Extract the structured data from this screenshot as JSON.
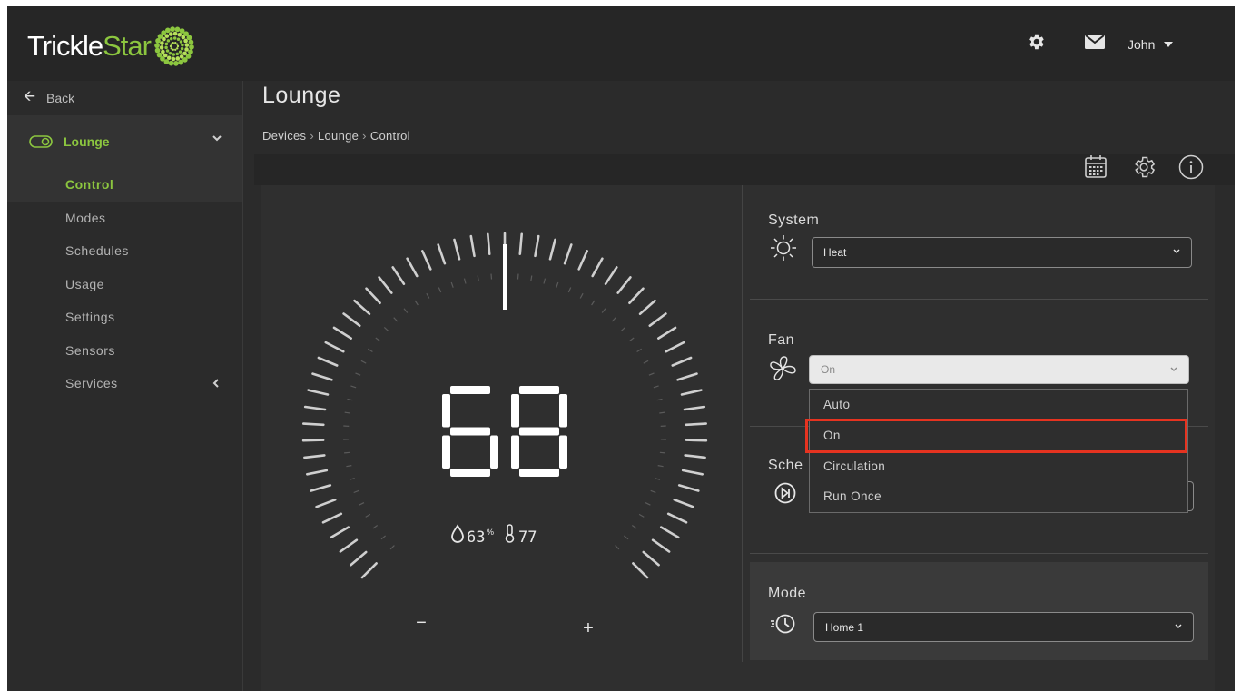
{
  "brand": {
    "name_part1": "Trickle",
    "name_part2": "Star",
    "accent": "#8cc63f"
  },
  "topbar": {
    "icons": [
      "gear-icon",
      "mail-icon"
    ],
    "user": "John"
  },
  "sidebar": {
    "back_label": "Back",
    "device": {
      "name": "Lounge",
      "icon": "toggle-icon"
    },
    "items": [
      {
        "label": "Control",
        "active": true
      },
      {
        "label": "Modes"
      },
      {
        "label": "Schedules"
      },
      {
        "label": "Usage"
      },
      {
        "label": "Settings"
      },
      {
        "label": "Sensors"
      },
      {
        "label": "Services"
      }
    ]
  },
  "page": {
    "title": "Lounge",
    "breadcrumb": [
      "Devices",
      "Lounge",
      "Control"
    ],
    "header_icons": [
      "calendar-icon",
      "settings-icon",
      "info-icon"
    ]
  },
  "thermostat": {
    "setpoint": "68",
    "humidity": "63",
    "humidity_unit": "%",
    "temperature": "77",
    "minus": "−",
    "plus": "+"
  },
  "controls": {
    "system": {
      "label": "System",
      "value": "Heat",
      "icon": "sun-icon"
    },
    "fan": {
      "label": "Fan",
      "value": "On",
      "icon": "fan-icon",
      "options": [
        "Auto",
        "On",
        "Circulation",
        "Run Once"
      ],
      "highlighted": "On"
    },
    "schedule": {
      "label": "Sche",
      "icon": "skip-icon"
    },
    "mode": {
      "label": "Mode",
      "value": "Home 1",
      "icon": "clock-icon"
    }
  },
  "colors": {
    "highlight": "#e63320",
    "background": "#2b2b2b"
  }
}
